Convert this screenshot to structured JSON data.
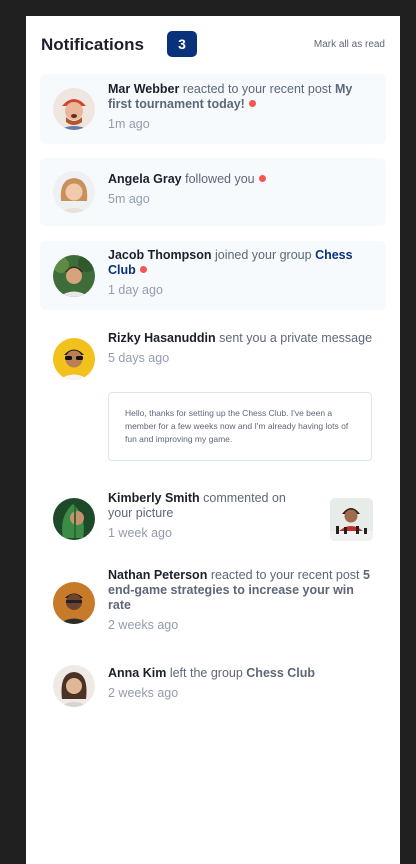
{
  "header": {
    "title": "Notifications",
    "count": "3",
    "mark_all": "Mark all as read"
  },
  "notifications": [
    {
      "actor": "Mar Webber",
      "action": "reacted to your recent post",
      "target": "My first tournament today!",
      "time": "1m ago",
      "unread": true
    },
    {
      "actor": "Angela Gray",
      "action": "followed you",
      "time": "5m ago",
      "unread": true
    },
    {
      "actor": "Jacob Thompson",
      "action": "joined your group",
      "target": "Chess Club",
      "time": "1 day ago",
      "unread": true
    },
    {
      "actor": "Rizky Hasanuddin",
      "action": "sent you a private message",
      "time": "5 days ago",
      "message": "Hello, thanks for setting up the Chess Club. I've been a member for a few weeks now and I'm already having lots of fun and improving my game.",
      "unread": false
    },
    {
      "actor": "Kimberly Smith",
      "action": "commented on your picture",
      "time": "1 week ago",
      "unread": false
    },
    {
      "actor": "Nathan Peterson",
      "action": "reacted to your recent post",
      "target": "5 end-game strategies to increase your win rate",
      "time": "2 weeks ago",
      "unread": false
    },
    {
      "actor": "Anna Kim",
      "action": "left the group",
      "target": "Chess Club",
      "time": "2 weeks ago",
      "unread": false
    }
  ]
}
